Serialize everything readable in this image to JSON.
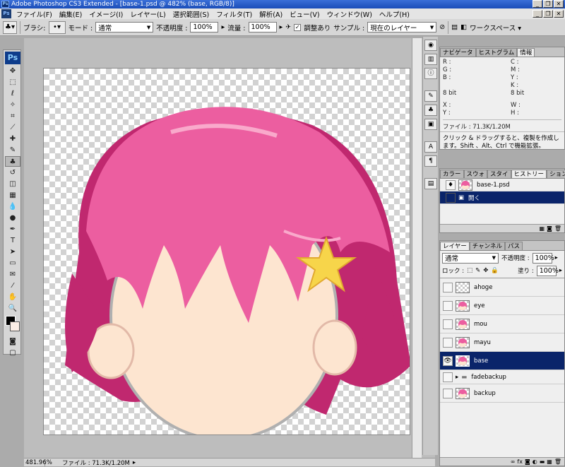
{
  "window": {
    "title": "Adobe Photoshop CS3 Extended - [base-1.psd @ 482% (base, RGB/8)]",
    "app_badge": "Ps"
  },
  "menubar": [
    "ファイル(F)",
    "編集(E)",
    "イメージ(I)",
    "レイヤー(L)",
    "選択範囲(S)",
    "フィルタ(T)",
    "解析(A)",
    "ビュー(V)",
    "ウィンドウ(W)",
    "ヘルプ(H)"
  ],
  "options": {
    "mode_label": "モード :",
    "mode_value": "通常",
    "opacity_label": "不透明度 :",
    "opacity_value": "100%",
    "flow_label": "流量 :",
    "flow_value": "100%",
    "aligned_label": "調整あり",
    "sample_label": "サンプル :",
    "sample_value": "現在のレイヤー",
    "workspace_label": "ワークスペース ▾"
  },
  "toolbox": {
    "logo": "Ps"
  },
  "status": {
    "zoom": "481.96%",
    "file_info": "ファイル : 71.3K/1.20M"
  },
  "info_panel": {
    "tabs": [
      "ナビゲータ",
      "ヒストグラム",
      "情報"
    ],
    "rgb": [
      "R :",
      "G :",
      "B :"
    ],
    "cmyk": [
      "C :",
      "M :",
      "Y :",
      "K :"
    ],
    "bits_left": "8 bit",
    "bits_right": "8 bit",
    "xy": [
      "X :",
      "Y :"
    ],
    "wh": [
      "W :",
      "H :"
    ],
    "file_line": "ファイル : 71.3K/1.20M",
    "hint": "クリック & ドラッグすると、複製を作成します。Shift 、Alt、Ctrl で機能拡張。"
  },
  "history_panel": {
    "tabs": [
      "カラー",
      "スウォ",
      "スタイ",
      "ヒストリー",
      "ション"
    ],
    "snapshot": "base-1.psd",
    "items": [
      "開く"
    ]
  },
  "layers_panel": {
    "tabs": [
      "レイヤー",
      "チャンネル",
      "パス"
    ],
    "blend_mode": "通常",
    "opacity_label": "不透明度 :",
    "opacity_value": "100%",
    "lock_label": "ロック :",
    "fill_label": "塗り :",
    "fill_value": "100%",
    "layers": [
      {
        "name": "ahoge",
        "visible": false,
        "selected": false
      },
      {
        "name": "eye",
        "visible": false,
        "selected": false
      },
      {
        "name": "mou",
        "visible": false,
        "selected": false
      },
      {
        "name": "mayu",
        "visible": false,
        "selected": false
      },
      {
        "name": "base",
        "visible": true,
        "selected": true
      },
      {
        "name": "fadebackup",
        "visible": false,
        "selected": false,
        "group": true
      },
      {
        "name": "backup",
        "visible": false,
        "selected": false
      }
    ]
  },
  "colors": {
    "hair": "#ec5ea0",
    "hair_dark": "#b8206a",
    "skin": "#fde5d0",
    "star": "#f7d54a",
    "selection": "#0a246a"
  }
}
